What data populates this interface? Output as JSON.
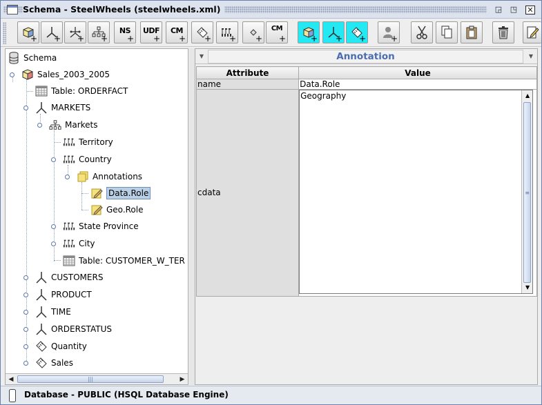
{
  "window": {
    "title": "Schema - SteelWheels (steelwheels.xml)",
    "controls": [
      "restore-icon",
      "maximize-icon",
      "close-icon"
    ]
  },
  "toolbar": {
    "buttons": [
      {
        "name": "add-cube-button",
        "label": "",
        "icon": "cube-add-icon"
      },
      {
        "name": "add-dimension-button",
        "label": "",
        "icon": "dimension-add-icon"
      },
      {
        "name": "add-dimension-usage-button",
        "label": "",
        "icon": "dimension-usage-add-icon"
      },
      {
        "name": "add-hierarchy-button",
        "label": "",
        "icon": "hierarchy-add-icon"
      },
      {
        "name": "add-named-set-button",
        "label": "NS",
        "icon": "named-set-icon"
      },
      {
        "name": "add-udf-button",
        "label": "UDF",
        "icon": "udf-icon"
      },
      {
        "name": "add-calculated-member-button",
        "label": "CM",
        "icon": "calculated-member-icon"
      },
      {
        "name": "add-measure-button",
        "label": "",
        "icon": "measure-add-icon"
      },
      {
        "name": "add-level-button",
        "label": "",
        "icon": "level-add-icon"
      },
      {
        "name": "add-property-button",
        "label": "",
        "icon": "property-add-icon"
      },
      {
        "name": "add-calculated-member-property-button",
        "label": "CM",
        "icon": "calculated-member-property-icon"
      },
      {
        "name": "add-virtual-cube-button",
        "label": "",
        "icon": "virtual-cube-icon"
      },
      {
        "name": "add-virtual-dimension-button",
        "label": "",
        "icon": "virtual-dimension-icon"
      },
      {
        "name": "add-virtual-measure-button",
        "label": "",
        "icon": "virtual-measure-icon"
      },
      {
        "name": "add-role-button",
        "label": "",
        "icon": "role-add-icon"
      },
      {
        "name": "cut-button",
        "label": "",
        "icon": "scissors-icon"
      },
      {
        "name": "copy-button",
        "label": "",
        "icon": "copy-icon"
      },
      {
        "name": "paste-button",
        "label": "",
        "icon": "paste-icon"
      },
      {
        "name": "delete-button",
        "label": "",
        "icon": "trash-icon"
      },
      {
        "name": "edit-button",
        "label": "",
        "icon": "edit-icon"
      }
    ]
  },
  "tree": {
    "nodes": [
      {
        "label": "Schema",
        "icon": "database-icon"
      },
      {
        "label": "Sales_2003_2005",
        "icon": "cube-icon"
      },
      {
        "label": "Table: ORDERFACT",
        "icon": "table-icon"
      },
      {
        "label": "MARKETS",
        "icon": "dimension-icon"
      },
      {
        "label": "Markets",
        "icon": "hierarchy-icon"
      },
      {
        "label": "Territory",
        "icon": "level-icon"
      },
      {
        "label": "Country",
        "icon": "level-icon"
      },
      {
        "label": "Annotations",
        "icon": "annotations-icon"
      },
      {
        "label": "Data.Role",
        "icon": "annotation-note-icon"
      },
      {
        "label": "Geo.Role",
        "icon": "annotation-note-icon"
      },
      {
        "label": "State Province",
        "icon": "level-icon"
      },
      {
        "label": "City",
        "icon": "level-icon"
      },
      {
        "label": "Table: CUSTOMER_W_TER",
        "icon": "table-icon"
      },
      {
        "label": "CUSTOMERS",
        "icon": "dimension-icon"
      },
      {
        "label": "PRODUCT",
        "icon": "dimension-icon"
      },
      {
        "label": "TIME",
        "icon": "dimension-icon"
      },
      {
        "label": "ORDERSTATUS",
        "icon": "dimension-icon"
      },
      {
        "label": "Quantity",
        "icon": "measure-icon"
      },
      {
        "label": "Sales",
        "icon": "measure-icon"
      }
    ],
    "selected": "Data.Role"
  },
  "detail": {
    "title": "Annotation",
    "columns": {
      "attribute": "Attribute",
      "value": "Value"
    },
    "rows": [
      {
        "attribute": "name",
        "value": "Data.Role"
      },
      {
        "attribute": "cdata",
        "value": "Geography"
      }
    ]
  },
  "status": {
    "text": "Database - PUBLIC (HSQL Database Engine)"
  }
}
